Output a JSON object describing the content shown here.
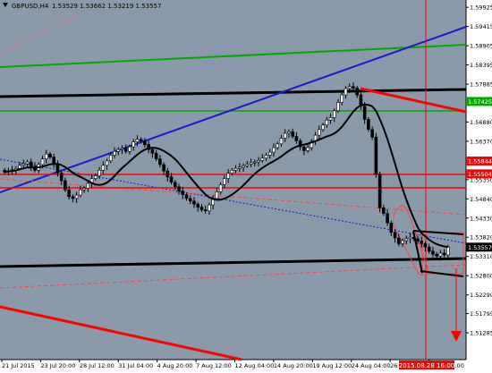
{
  "header": {
    "symbol": "GBPUSD,H4",
    "ohlc": "1.53529 1.53662 1.53219 1.53557"
  },
  "colors": {
    "background": "#8a9aaa",
    "bull": "#000000",
    "bear": "#000000",
    "axis_bg": "#ffffff",
    "red": "#ff0000",
    "green": "#00aa00",
    "blue": "#0000cc"
  },
  "chart_data": {
    "type": "candlestick",
    "title": "GBPUSD,H4",
    "ylim": [
      1.51285,
      1.6
    ],
    "price_ticks": [
      "1.59925",
      "1.59415",
      "1.58905",
      "1.58395",
      "1.57885",
      "1.57375",
      "1.56880",
      "1.56370",
      "1.55860",
      "1.55350",
      "1.54840",
      "1.54330",
      "1.53820",
      "1.53310",
      "1.52800",
      "1.52290",
      "1.51795",
      "1.51285"
    ],
    "time_labels": [
      "21 Jul 2015",
      "23 Jul 20:00",
      "28 Jul 12:00",
      "31 Jul 04:00",
      "4 Aug 20:00",
      "7 Aug 12:00",
      "12 Aug 04:00",
      "14 Aug 20:00",
      "19 Aug 12:00",
      "24 Aug 04:00",
      "26 Aug 20:00",
      "1 Sep 12:00"
    ],
    "price_badges": [
      {
        "value": "1.57425",
        "color": "#00aa00"
      },
      {
        "value": "1.55844",
        "color": "#ff0000"
      },
      {
        "value": "1.55504",
        "color": "#ff0000"
      },
      {
        "value": "1.53557",
        "color": "#000000"
      }
    ],
    "time_badge": "2015.08.28 16:00",
    "current_price": 1.53557,
    "closes": [
      1.5555,
      1.5558,
      1.5561,
      1.5565,
      1.5573,
      1.5577,
      1.5582,
      1.557,
      1.556,
      1.5575,
      1.559,
      1.5603,
      1.5595,
      1.5575,
      1.5553,
      1.5532,
      1.5508,
      1.549,
      1.5485,
      1.5494,
      1.5508,
      1.5512,
      1.5525,
      1.5538,
      1.5545,
      1.556,
      1.5573,
      1.5585,
      1.56,
      1.561,
      1.5615,
      1.5618,
      1.561,
      1.5622,
      1.5635,
      1.5642,
      1.5637,
      1.5628,
      1.5615,
      1.5605,
      1.559,
      1.5575,
      1.5558,
      1.5542,
      1.5528,
      1.5516,
      1.5505,
      1.5495,
      1.5485,
      1.5478,
      1.547,
      1.5462,
      1.5455,
      1.5452,
      1.5468,
      1.5485,
      1.5503,
      1.5522,
      1.5538,
      1.5552,
      1.556,
      1.5565,
      1.5568,
      1.5572,
      1.5576,
      1.558,
      1.5582,
      1.5586,
      1.5592,
      1.56,
      1.5608,
      1.562,
      1.563,
      1.5645,
      1.5658,
      1.5662,
      1.565,
      1.5638,
      1.5622,
      1.5612,
      1.562,
      1.5637,
      1.5653,
      1.5668,
      1.568,
      1.5693,
      1.57,
      1.5718,
      1.574,
      1.576,
      1.5777,
      1.5782,
      1.5778,
      1.576,
      1.573,
      1.5695,
      1.5668,
      1.5648,
      1.555,
      1.546,
      1.5445,
      1.542,
      1.5395,
      1.538,
      1.5365,
      1.5373,
      1.5378,
      1.5382,
      1.5378,
      1.5372,
      1.5365,
      1.5356,
      1.5345,
      1.5337,
      1.5332,
      1.534,
      1.5335,
      1.5356
    ]
  }
}
